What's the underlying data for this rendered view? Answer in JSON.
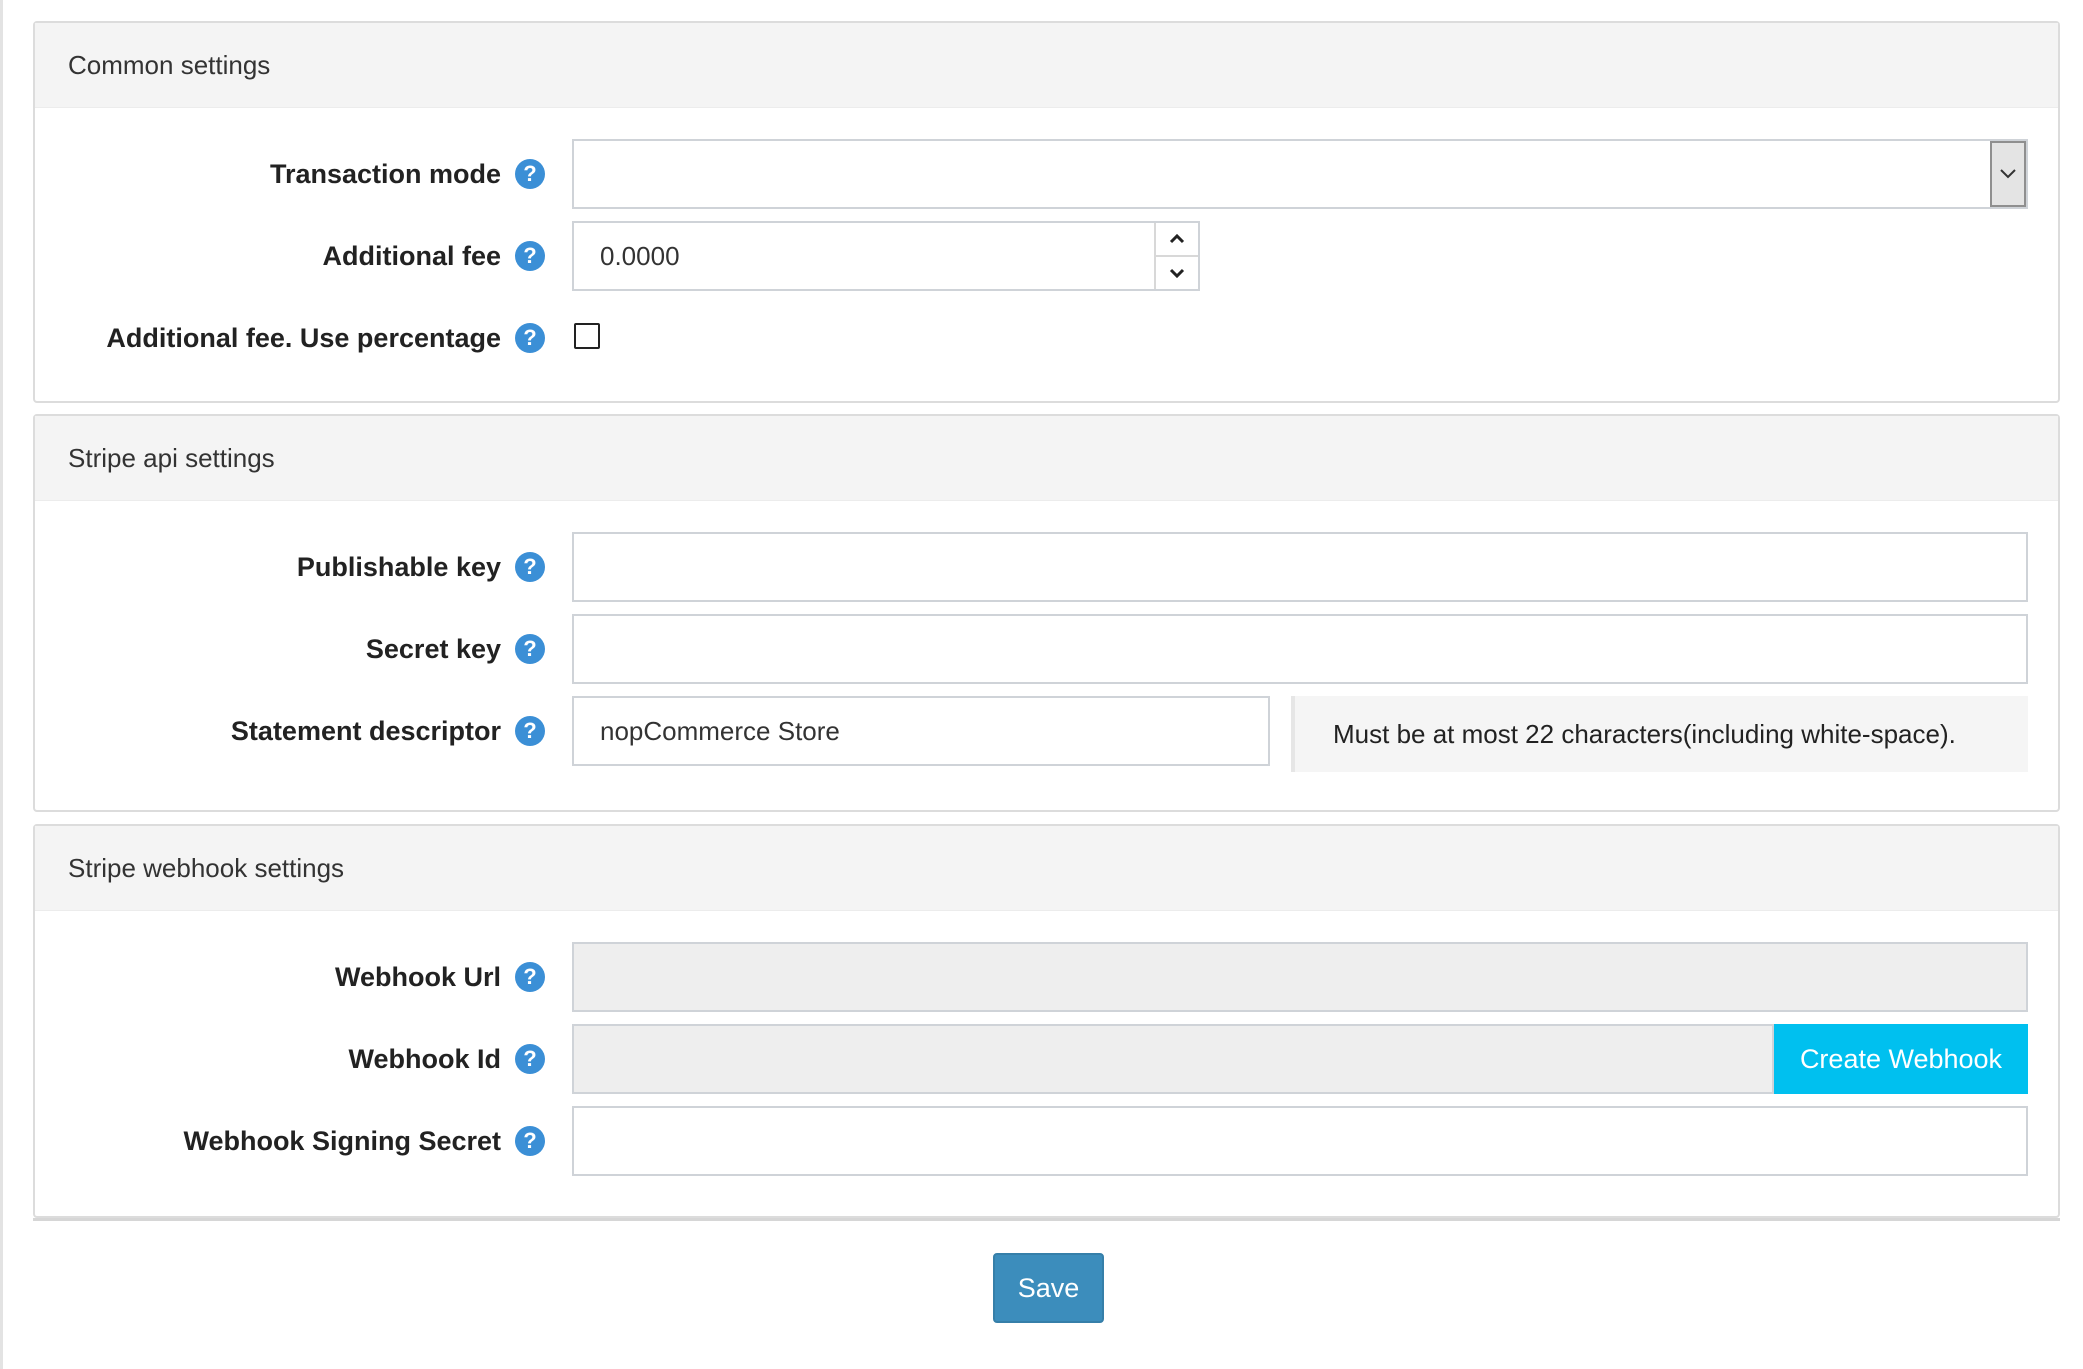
{
  "common": {
    "title": "Common settings",
    "transaction_mode": {
      "label": "Transaction mode",
      "value": ""
    },
    "additional_fee": {
      "label": "Additional fee",
      "value": "0.0000"
    },
    "use_percentage": {
      "label": "Additional fee. Use percentage",
      "checked": false
    }
  },
  "stripe_api": {
    "title": "Stripe api settings",
    "publishable_key": {
      "label": "Publishable key",
      "value": ""
    },
    "secret_key": {
      "label": "Secret key",
      "value": ""
    },
    "statement_descriptor": {
      "label": "Statement descriptor",
      "value": "nopCommerce Store",
      "hint": "Must be at most 22 characters(including white-space)."
    }
  },
  "webhook": {
    "title": "Stripe webhook settings",
    "url": {
      "label": "Webhook Url",
      "value": ""
    },
    "id": {
      "label": "Webhook Id",
      "value": "",
      "button": "Create Webhook"
    },
    "secret": {
      "label": "Webhook Signing Secret",
      "value": ""
    }
  },
  "help_glyph": "?",
  "save_label": "Save",
  "colors": {
    "help_icon": "#3b8fd6",
    "create_webhook_button": "#00c0ef",
    "save_button": "#3c8dbc"
  }
}
